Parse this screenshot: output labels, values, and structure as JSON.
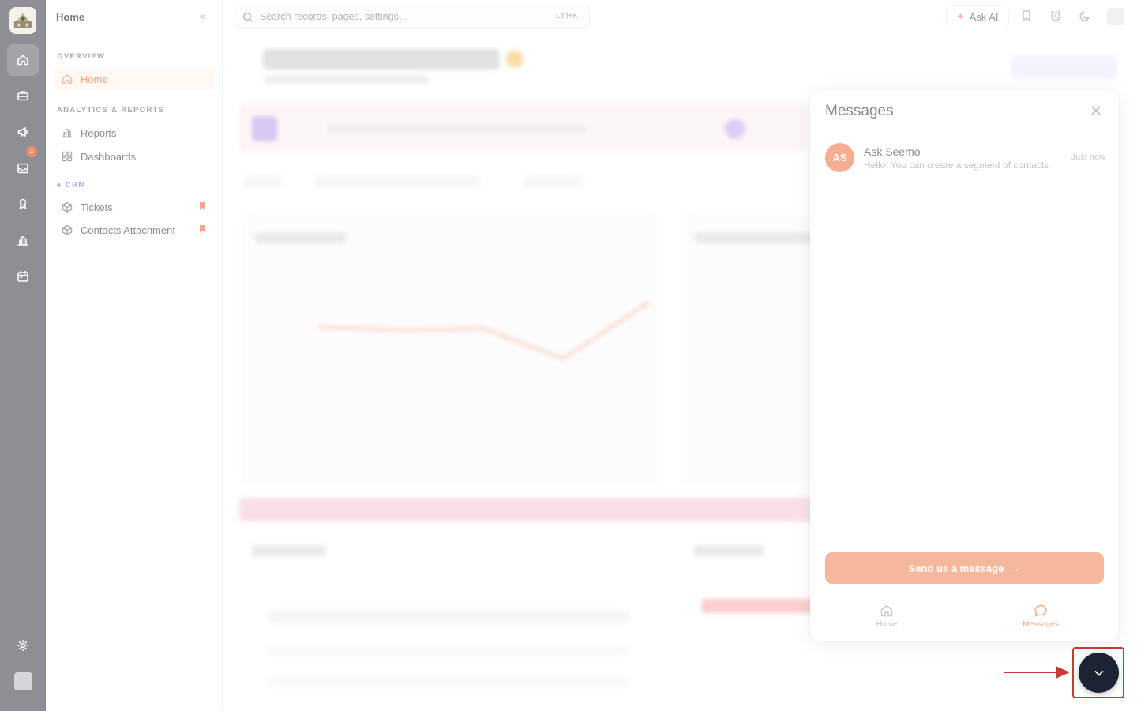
{
  "rail": {
    "badge_count": "2"
  },
  "sidebar": {
    "title": "Home",
    "sections": {
      "overview": "OVERVIEW",
      "analytics": "ANALYTICS & REPORTS",
      "crm": "CRM"
    },
    "items": {
      "home": "Home",
      "reports": "Reports",
      "dashboards": "Dashboards",
      "tickets": "Tickets",
      "contacts_attachment": "Contacts Attachment"
    }
  },
  "topbar": {
    "search_placeholder": "Search records, pages, settings…",
    "search_shortcut": "Ctrl+K",
    "ask_ai_label": "Ask AI"
  },
  "messages": {
    "title": "Messages",
    "conversation": {
      "avatar_initials": "AS",
      "name": "Ask Seemo",
      "preview": "Hello! You can create a segment of contacts",
      "time": "Just now"
    },
    "send_button_label": "Send us a message",
    "tabs": {
      "home": "Home",
      "messages": "Messages"
    }
  },
  "colors": {
    "accent": "#f5a885",
    "rail": "#8e8f95",
    "launcher": "#1c2433",
    "highlight": "#c93a35"
  }
}
